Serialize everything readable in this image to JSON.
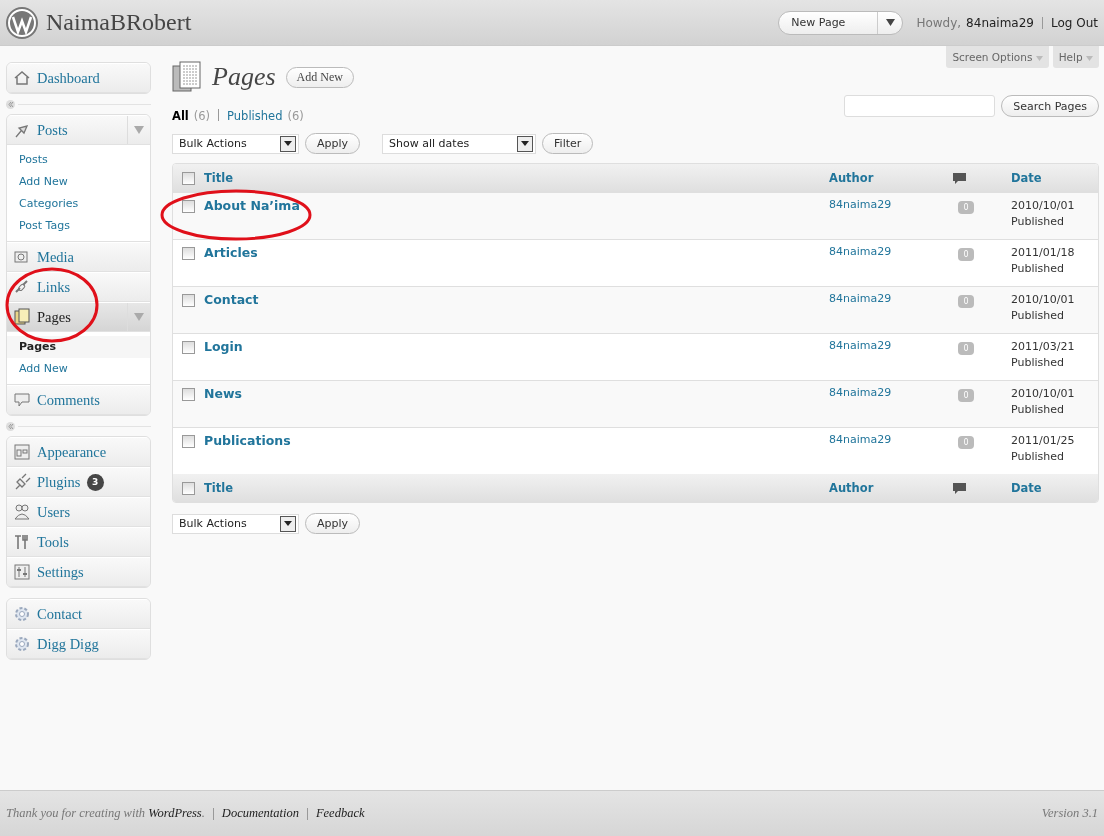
{
  "header": {
    "site_title": "NaimaBRobert",
    "new_button": "New Page",
    "greeting": "Howdy,",
    "user": "84naima29",
    "logout": "Log Out"
  },
  "screen_tabs": [
    "Screen Options",
    "Help"
  ],
  "sidebar": {
    "groups": [
      {
        "items": [
          {
            "label": "Dashboard",
            "expanded": false,
            "selected": false
          }
        ]
      },
      {
        "items": [
          {
            "label": "Posts",
            "expanded": true,
            "selected": false,
            "children": [
              {
                "label": "Posts",
                "selected": false
              },
              {
                "label": "Add New",
                "selected": false
              },
              {
                "label": "Categories",
                "selected": false
              },
              {
                "label": "Post Tags",
                "selected": false
              }
            ]
          },
          {
            "label": "Media",
            "expanded": false,
            "selected": false
          },
          {
            "label": "Links",
            "expanded": false,
            "selected": false
          },
          {
            "label": "Pages",
            "expanded": true,
            "selected": true,
            "children": [
              {
                "label": "Pages",
                "selected": true
              },
              {
                "label": "Add New",
                "selected": false
              }
            ]
          },
          {
            "label": "Comments",
            "expanded": false,
            "selected": false
          }
        ]
      },
      {
        "items": [
          {
            "label": "Appearance",
            "expanded": false,
            "selected": false
          },
          {
            "label": "Plugins",
            "expanded": false,
            "selected": false,
            "badge": "3"
          },
          {
            "label": "Users",
            "expanded": false,
            "selected": false
          },
          {
            "label": "Tools",
            "expanded": false,
            "selected": false
          },
          {
            "label": "Settings",
            "expanded": false,
            "selected": false
          }
        ]
      },
      {
        "items": [
          {
            "label": "Contact",
            "expanded": false,
            "selected": false
          },
          {
            "label": "Digg Digg",
            "expanded": false,
            "selected": false
          }
        ]
      }
    ]
  },
  "page": {
    "title": "Pages",
    "add_new": "Add New"
  },
  "filters": [
    {
      "label": "All",
      "count": "(6)",
      "selected": true
    },
    {
      "label": "Published",
      "count": "(6)",
      "selected": false
    }
  ],
  "search": {
    "button": "Search Pages"
  },
  "bulk_actions": {
    "value": "Bulk Actions",
    "apply": "Apply"
  },
  "date_filter": {
    "value": "Show all dates",
    "button": "Filter"
  },
  "table": {
    "header": {
      "checked": false,
      "columns": [
        "Title",
        "Author",
        "Date"
      ]
    },
    "footer": {
      "checked": false,
      "columns": [
        "Title",
        "Author",
        "Date"
      ]
    },
    "rows": [
      {
        "title": "About Na’ima",
        "author": "84naima29",
        "comments": "0",
        "date": "2010/10/01",
        "status": "Published",
        "checked": false
      },
      {
        "title": "Articles",
        "author": "84naima29",
        "comments": "0",
        "date": "2011/01/18",
        "status": "Published",
        "checked": false
      },
      {
        "title": "Contact",
        "author": "84naima29",
        "comments": "0",
        "date": "2010/10/01",
        "status": "Published",
        "checked": false
      },
      {
        "title": "Login",
        "author": "84naima29",
        "comments": "0",
        "date": "2011/03/21",
        "status": "Published",
        "checked": false
      },
      {
        "title": "News",
        "author": "84naima29",
        "comments": "0",
        "date": "2010/10/01",
        "status": "Published",
        "checked": false
      },
      {
        "title": "Publications",
        "author": "84naima29",
        "comments": "0",
        "date": "2011/01/25",
        "status": "Published",
        "checked": false
      }
    ]
  },
  "bottom_actions": {
    "value": "Bulk Actions",
    "apply": "Apply"
  },
  "footer": {
    "thanks": "Thank you for creating with **WordPress**.",
    "links": [
      "Documentation",
      "Feedback"
    ],
    "version": "Version 3.1"
  }
}
